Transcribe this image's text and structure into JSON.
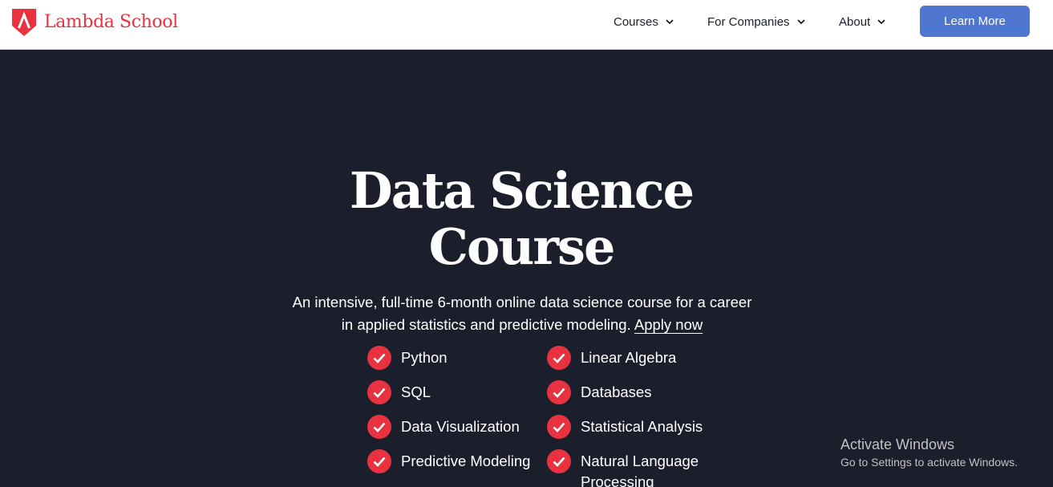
{
  "brand": {
    "name": "Lambda School",
    "accent": "#e8323f"
  },
  "nav": {
    "items": [
      {
        "label": "Courses",
        "icon": "chevron-down-icon"
      },
      {
        "label": "For Companies",
        "icon": "chevron-down-icon"
      },
      {
        "label": "About",
        "icon": "chevron-down-icon"
      }
    ],
    "cta": {
      "label": "Learn More",
      "color": "#4f77cf"
    }
  },
  "hero": {
    "title_line1": "Data Science",
    "title_line2": "Course",
    "description": "An intensive, full-time 6-month online data science course for a career in applied statistics and predictive modeling.",
    "apply_link": "Apply now",
    "background": "#1b1f2b"
  },
  "features": [
    {
      "label": "Python",
      "icon": "check-icon"
    },
    {
      "label": "Linear Algebra",
      "icon": "check-icon"
    },
    {
      "label": "SQL",
      "icon": "check-icon"
    },
    {
      "label": "Databases",
      "icon": "check-icon"
    },
    {
      "label": "Data Visualization",
      "icon": "check-icon"
    },
    {
      "label": "Statistical Analysis",
      "icon": "check-icon"
    },
    {
      "label": "Predictive Modeling",
      "icon": "check-icon"
    },
    {
      "label": "Natural Language Processing",
      "icon": "check-icon"
    }
  ],
  "os_watermark": {
    "title": "Activate Windows",
    "subtitle": "Go to Settings to activate Windows."
  }
}
